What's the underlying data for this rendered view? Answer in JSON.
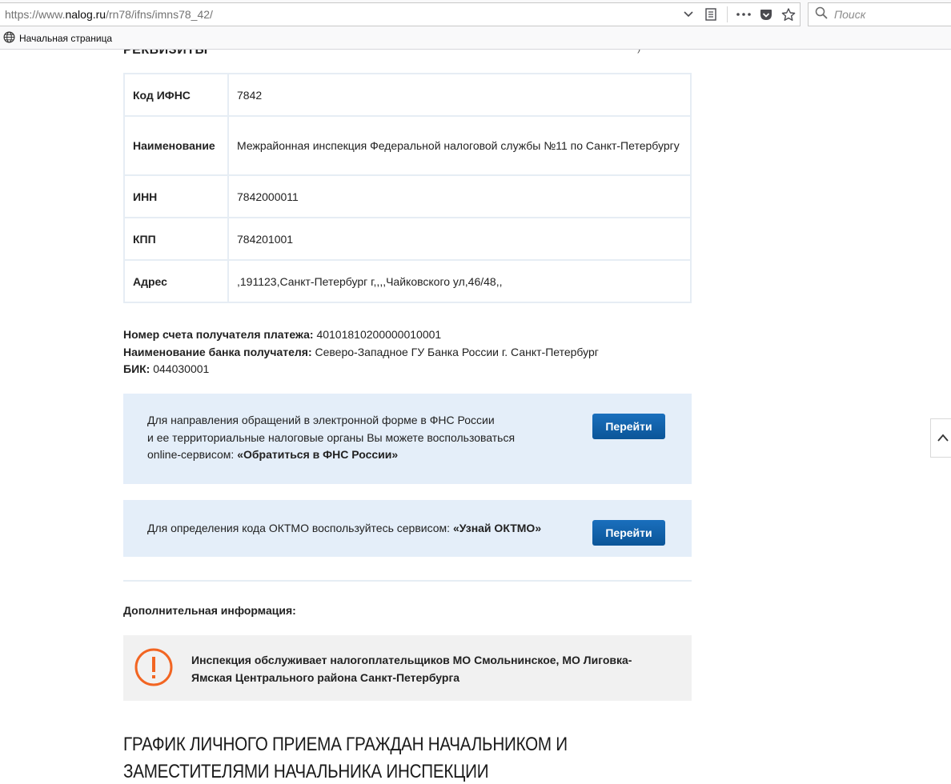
{
  "browser": {
    "url_prefix": "https://www.",
    "url_domain": "nalog.ru",
    "url_path": "/rn78/ifns/imns78_42/",
    "search_placeholder": "Поиск",
    "bookmark_label": "Начальная страница",
    "icons": [
      "chevron-down-icon",
      "reader-view-icon",
      "page-actions-icon",
      "pocket-icon",
      "bookmark-star-icon",
      "search-icon",
      "globe-icon"
    ]
  },
  "section": {
    "cut_heading": "РЕКВИЗИТЫ",
    "cut_heading_right": "' )"
  },
  "requisites": [
    {
      "key": "Код ИФНС",
      "value": "7842"
    },
    {
      "key": "Наименование",
      "value": "Межрайонная инспекция Федеральной налоговой службы №11 по Санкт-Петербургу"
    },
    {
      "key": "ИНН",
      "value": "7842000011"
    },
    {
      "key": "КПП",
      "value": "784201001"
    },
    {
      "key": "Адрес",
      "value": ",191123,Санкт-Петербург г,,,,Чайковского ул,46/48,,"
    }
  ],
  "bank": {
    "account_label": "Номер счета получателя платежа:",
    "account_value": " 40101810200000010001",
    "bank_label": "Наименование банка получателя:",
    "bank_value": " Северо-Западное ГУ Банка России г. Санкт-Петербург",
    "bik_label": "БИК:",
    "bik_value": " 044030001"
  },
  "appeal_box": {
    "line1": "Для направления обращений в электронной форме в ФНС России",
    "line2": "и ее территориальные налоговые органы Вы можете воспользоваться",
    "line3_prefix": "online-сервисом: ",
    "line3_link": "«Обратиться в ФНС России»",
    "button_label": "Перейти"
  },
  "oktmo_box": {
    "text_prefix": "Для определения кода ОКТМО воспользуйтесь сервисом: ",
    "text_link": "«Узнай ОКТМО»",
    "button_label": "Перейти"
  },
  "extra_info": {
    "title": "Дополнительная информация:",
    "warning_line1": "Инспекция обслуживает налогоплательщиков МО Смольнинское, МО Лиговка-",
    "warning_line2": "Ямская Центрального района Санкт-Петербурга",
    "warning_color": "#f26522"
  },
  "schedule": {
    "heading_line1": "ГРАФИК ЛИЧНОГО ПРИЕМА ГРАЖДАН НАЧАЛЬНИКОМ И",
    "heading_line2": "ЗАМЕСТИТЕЛЯМИ НАЧАЛЬНИКА ИНСПЕКЦИИ"
  },
  "colors": {
    "button_blue": "#0d5ea5",
    "info_box_bg": "#e4eef9",
    "warn_box_bg": "#f1f1f1",
    "table_border": "#e6edf4"
  }
}
